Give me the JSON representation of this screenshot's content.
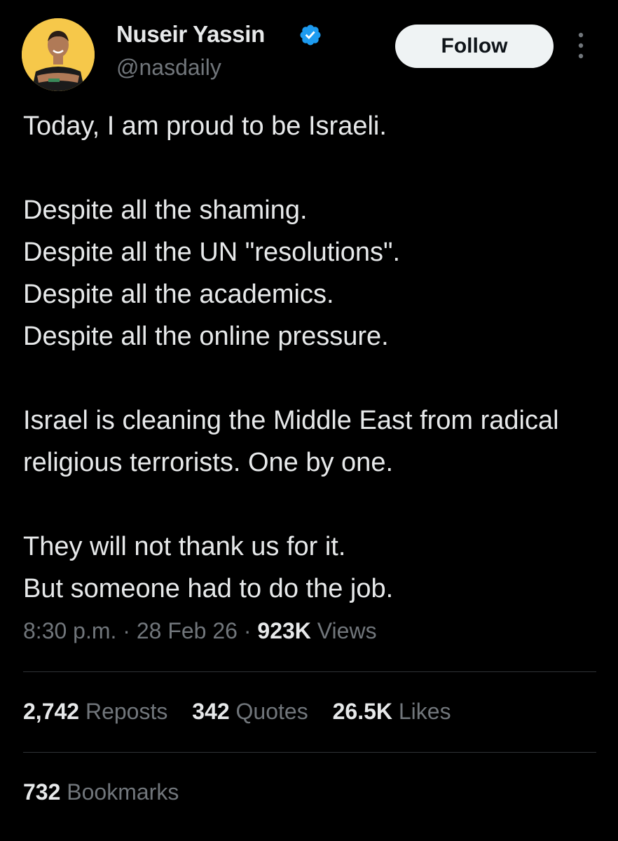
{
  "author": {
    "display_name": "Nuseir Yassin",
    "handle": "@nasdaily",
    "verified": true,
    "avatar_icon": "profile-photo",
    "verified_icon": "verified-badge-icon"
  },
  "follow_button": {
    "label": "Follow"
  },
  "more_menu": {
    "icon": "more-vertical-icon"
  },
  "tweet": {
    "text": "Today, I am proud to be Israeli.\n\nDespite all the shaming.\nDespite all the UN \"resolutions\".\nDespite all the academics.\nDespite all the online pressure.\n\nIsrael is cleaning the Middle East from radical religious terrorists. One by one.\n\nThey will not thank us for it.\nBut someone had to do the job."
  },
  "meta": {
    "time": "8:30 p.m.",
    "separator": " · ",
    "date": "28 Feb 26",
    "views_count": "923K",
    "views_label": " Views"
  },
  "stats": {
    "reposts_count": "2,742",
    "reposts_label": " Reposts",
    "quotes_count": "342",
    "quotes_label": " Quotes",
    "likes_count": "26.5K",
    "likes_label": " Likes",
    "bookmarks_count": "732",
    "bookmarks_label": " Bookmarks"
  },
  "colors": {
    "background": "#000000",
    "text_primary": "#e7e9ea",
    "text_secondary": "#71767b",
    "verified_blue": "#1d9bf0",
    "avatar_bg": "#f6c84a",
    "button_bg": "#eff3f4",
    "divider": "#2f3336"
  }
}
